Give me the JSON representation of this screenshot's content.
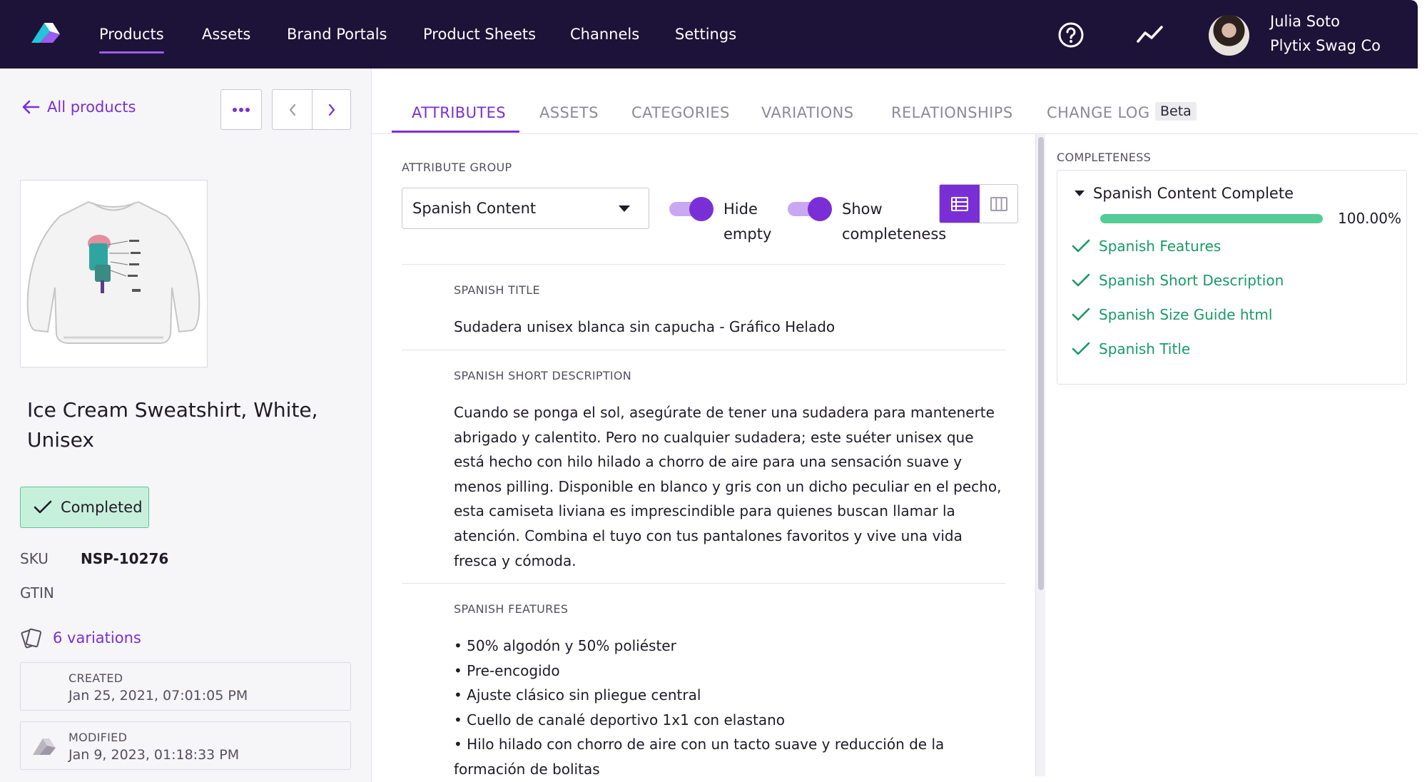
{
  "topnav": {
    "items": [
      {
        "label": "Products",
        "active": true
      },
      {
        "label": "Assets"
      },
      {
        "label": "Brand Portals"
      },
      {
        "label": "Product Sheets"
      },
      {
        "label": "Channels"
      },
      {
        "label": "Settings"
      }
    ],
    "help_icon": "help-circle-icon",
    "activity_icon": "activity-icon",
    "user": {
      "name": "Julia Soto",
      "company": "Plytix Swag Co"
    }
  },
  "sidebar": {
    "back_label": "All products",
    "more_icon": "ellipsis-icon",
    "product": {
      "title": "Ice Cream Sweatshirt, White, Unisex",
      "status": "Completed",
      "fields": [
        {
          "label": "SKU",
          "value": "NSP-10276"
        },
        {
          "label": "GTIN",
          "value": ""
        }
      ],
      "variations_label": "6 variations",
      "created": {
        "label": "CREATED",
        "value": "Jan 25, 2021, 07:01:05 PM"
      },
      "modified": {
        "label": "MODIFIED",
        "value": "Jan 9, 2023, 01:18:33 PM"
      }
    }
  },
  "tabs": [
    {
      "label": "ATTRIBUTES",
      "active": true
    },
    {
      "label": "ASSETS"
    },
    {
      "label": "CATEGORIES"
    },
    {
      "label": "VARIATIONS"
    },
    {
      "label": "RELATIONSHIPS"
    },
    {
      "label": "CHANGE LOG",
      "badge": "Beta"
    }
  ],
  "attribute_panel": {
    "group_label": "ATTRIBUTE GROUP",
    "group_value": "Spanish Content",
    "toggles": [
      {
        "label_line1": "Hide",
        "label_line2": "empty",
        "on": true
      },
      {
        "label_line1": "Show",
        "label_line2": "completeness",
        "on": true
      }
    ],
    "view_mode": "list",
    "attributes": [
      {
        "label": "SPANISH TITLE",
        "lines": [
          "Sudadera unisex blanca sin capucha - Gráfico Helado"
        ]
      },
      {
        "label": "SPANISH SHORT DESCRIPTION",
        "lines": [
          "Cuando se ponga el sol, asegúrate de tener una sudadera para mantenerte",
          "abrigado y calentito. Pero no cualquier sudadera; este suéter unisex que",
          "está hecho con hilo hilado a chorro de aire para una sensación suave y",
          "menos pilling. Disponible en blanco y gris con un dicho peculiar en el pecho,",
          "esta camiseta liviana es imprescindible para quienes buscan llamar la",
          "atención. Combina el tuyo con tus pantalones favoritos y vive una vida",
          "fresca y cómoda."
        ]
      },
      {
        "label": "SPANISH FEATURES",
        "lines": [
          "• 50% algodón y 50% poliéster",
          "• Pre-encogido",
          "• Ajuste clásico sin pliegue central",
          "• Cuello de canalé deportivo 1x1 con elastano",
          "• Hilo hilado con chorro de aire con un tacto suave y reducción de la",
          "formación de bolitas"
        ]
      }
    ]
  },
  "completeness": {
    "title": "COMPLETENESS",
    "group": "Spanish Content Complete",
    "progress": 1.0,
    "progress_text": "100.00%",
    "items": [
      "Spanish Features",
      "Spanish Short Description",
      "Spanish Size Guide html",
      "Spanish Title"
    ],
    "colors": {
      "accent": "#7a2fd6",
      "success": "#1a9a68",
      "progress": "#55cc96",
      "nav_bg": "#1d1238"
    }
  }
}
